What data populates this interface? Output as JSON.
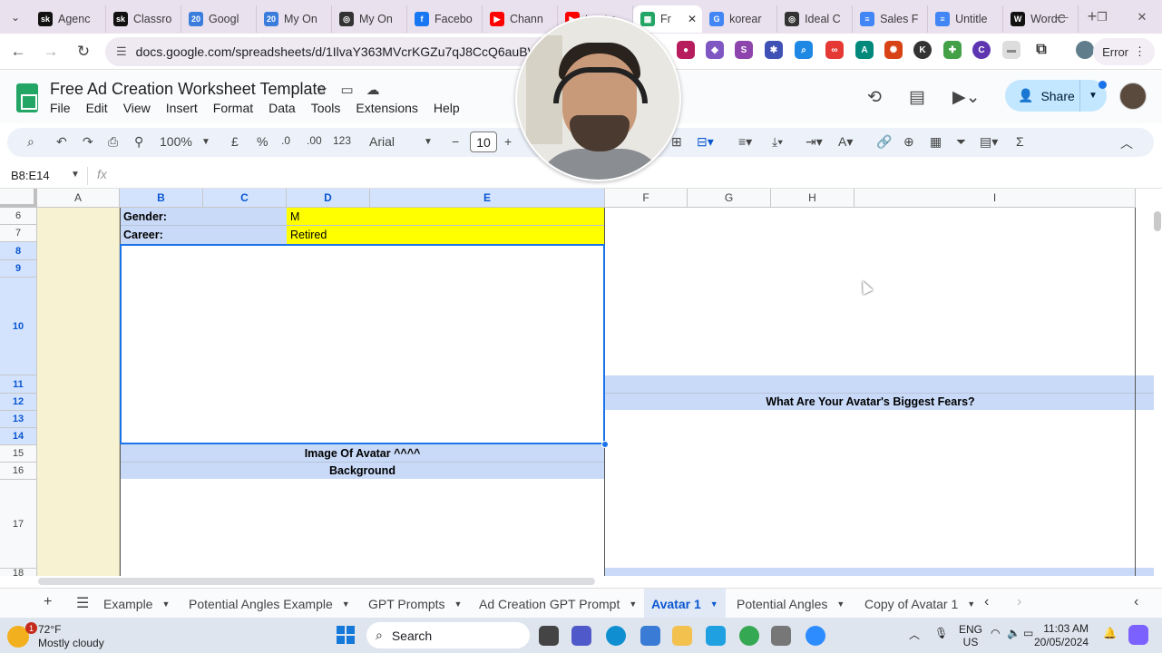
{
  "browser": {
    "tabs": [
      {
        "label": "Agenc",
        "icon": "sk-icon",
        "color": "#111111",
        "glyph": "sk"
      },
      {
        "label": "Classro",
        "icon": "sk-icon",
        "color": "#111111",
        "glyph": "sk"
      },
      {
        "label": "Googl",
        "icon": "calendar-icon",
        "color": "#3b7ddd",
        "glyph": "20"
      },
      {
        "label": "My On",
        "icon": "calendar-icon",
        "color": "#3b7ddd",
        "glyph": "20"
      },
      {
        "label": "My On",
        "icon": "chatgpt-icon",
        "color": "#333333",
        "glyph": "◎"
      },
      {
        "label": "Facebo",
        "icon": "facebook-icon",
        "color": "#1877f2",
        "glyph": "f"
      },
      {
        "label": "Chann",
        "icon": "youtube-icon",
        "color": "#ff0000",
        "glyph": "▶"
      },
      {
        "label": "tarot r",
        "icon": "youtube-icon",
        "color": "#ff0000",
        "glyph": "▶"
      },
      {
        "label": "Fr",
        "icon": "sheets-icon",
        "color": "#23a566",
        "glyph": "▦",
        "active": true
      },
      {
        "label": "korear",
        "icon": "google-icon",
        "color": "#4285f4",
        "glyph": "G"
      },
      {
        "label": "Ideal C",
        "icon": "chatgpt-icon",
        "color": "#333333",
        "glyph": "◎"
      },
      {
        "label": "Sales F",
        "icon": "docs-icon",
        "color": "#4285f4",
        "glyph": "≡"
      },
      {
        "label": "Untitle",
        "icon": "docs-icon",
        "color": "#4285f4",
        "glyph": "≡"
      },
      {
        "label": "WordC",
        "icon": "word-icon",
        "color": "#111111",
        "glyph": "W"
      }
    ],
    "url": "docs.google.com/spreadsheets/d/1IlvaY363MVcrKGZu7qJ8CcQ6auBVJSOPVMa",
    "profile_label": "Error"
  },
  "sheets": {
    "title": "Free Ad Creation Worksheet Template",
    "menu": [
      "File",
      "Edit",
      "View",
      "Insert",
      "Format",
      "Data",
      "Tools",
      "Extensions",
      "Help"
    ],
    "share_label": "Share",
    "toolbar": {
      "zoom": "100%",
      "currency": "£",
      "percent": "%",
      "dec_decrease": ".0",
      "dec_increase": ".00",
      "number_format": "123",
      "font": "Arial",
      "font_size": "10"
    },
    "name_box": "B8:E14",
    "fx_label": "fx"
  },
  "grid": {
    "columns": [
      "A",
      "B",
      "C",
      "D",
      "E",
      "F",
      "G",
      "H",
      "I"
    ],
    "selected_columns": [
      "B",
      "C",
      "D",
      "E"
    ],
    "rows": [
      "6",
      "7",
      "8",
      "9",
      "10",
      "11",
      "12",
      "13",
      "14",
      "15",
      "16",
      "17",
      "18"
    ],
    "selected_rows": [
      "8",
      "9",
      "10",
      "11",
      "12",
      "13",
      "14"
    ],
    "cells": {
      "b6": "Gender:",
      "d6": "M",
      "b7": "Career:",
      "d7": "Retired",
      "f12": "What Are Your Avatar's Biggest Fears?",
      "b15": "Image Of Avatar ^^^^",
      "b16": "Background"
    },
    "colors": {
      "yellow": "#ffff00",
      "band": "#c9daf8",
      "col_a": "#f7f2d2",
      "selection": "#1a73e8"
    }
  },
  "sheet_tabs": [
    {
      "label": "Example"
    },
    {
      "label": "Potential Angles Example"
    },
    {
      "label": "GPT Prompts"
    },
    {
      "label": "Ad Creation GPT Prompt"
    },
    {
      "label": "Avatar 1",
      "active": true
    },
    {
      "label": "Potential Angles"
    },
    {
      "label": "Copy of Avatar 1"
    }
  ],
  "taskbar": {
    "weather_temp": "72°F",
    "weather_cond": "Mostly cloudy",
    "weather_badge": "1",
    "search_label": "Search",
    "lang": "ENG",
    "region": "US",
    "time": "11:03 AM",
    "date": "20/05/2024"
  }
}
